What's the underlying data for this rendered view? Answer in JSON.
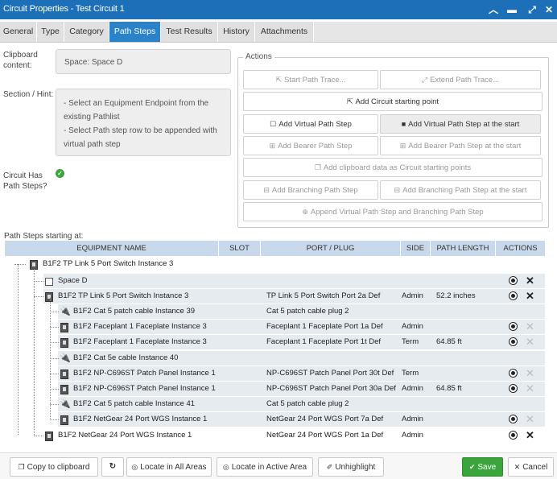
{
  "window": {
    "title": "Circuit Properties - Test Circuit 1",
    "controls": [
      "chevron-up",
      "minimize",
      "expand",
      "close"
    ]
  },
  "tabs": [
    {
      "label": "General",
      "active": false
    },
    {
      "label": "Type",
      "active": false
    },
    {
      "label": "Category",
      "active": false
    },
    {
      "label": "Path Steps",
      "active": true
    },
    {
      "label": "Test Results",
      "active": false
    },
    {
      "label": "History",
      "active": false
    },
    {
      "label": "Attachments",
      "active": false
    }
  ],
  "left": {
    "clipboard_label": "Clipboard content:",
    "clipboard_value": "Space: Space D",
    "hint_label": "Section / Hint:",
    "hint_line1": "- Select an Equipment Endpoint from the existing Pathlist",
    "hint_line2": "- Select Path step row to be appended with virtual path step",
    "has_steps_label": "Circuit Has Path Steps?"
  },
  "actions": {
    "legend": "Actions",
    "start_trace": "Start Path Trace...",
    "extend_trace": "Extend Path Trace...",
    "add_start_point": "Add Circuit starting point",
    "add_virtual": "Add Virtual Path Step",
    "add_virtual_start": "Add Virtual Path Step at the start",
    "add_bearer": "Add Bearer Path Step",
    "add_bearer_start": "Add Bearer Path Step at the start",
    "add_clipboard": "Add clipboard data as Circuit starting points",
    "add_branching": "Add Branching Path Step",
    "add_branching_start": "Add Branching Path Step at the start",
    "append_virtual_branching": "Append Virtual Path Step and Branching Path Step"
  },
  "grid": {
    "caption": "Path Steps starting at:",
    "columns": [
      "EQUIPMENT NAME",
      "SLOT",
      "PORT / PLUG",
      "SIDE",
      "PATH LENGTH",
      "ACTIONS"
    ],
    "root": "B1F2 TP Link 5 Port Switch Instance 3",
    "rows": [
      {
        "name": "Space D",
        "port": "",
        "side": "",
        "length": "",
        "icon": "space",
        "target": true,
        "x": "active"
      },
      {
        "name": "B1F2 TP Link 5 Port Switch Instance 3",
        "port": "TP Link 5 Port Switch Port 2a Def",
        "side": "Admin",
        "length": "52.2 inches",
        "icon": "equipment",
        "target": true,
        "x": "active"
      },
      {
        "name": "B1F2 Cat 5 patch cable Instance 39",
        "port": "Cat 5 patch cable plug 2",
        "side": "",
        "length": "",
        "icon": "cable",
        "target": false,
        "x": "none"
      },
      {
        "name": "B1F2 Faceplant 1 Faceplate Instance 3",
        "port": "Faceplant 1 Faceplate Port 1a Def",
        "side": "Admin",
        "length": "",
        "icon": "equipment",
        "target": true,
        "x": "disabled"
      },
      {
        "name": "B1F2 Faceplant 1 Faceplate Instance 3",
        "port": "Faceplant 1 Faceplate Port 1t Def",
        "side": "Term",
        "length": "64.85 ft",
        "icon": "equipment",
        "target": true,
        "x": "disabled"
      },
      {
        "name": "B1F2 Cat 5e cable Instance 40",
        "port": "",
        "side": "",
        "length": "",
        "icon": "cable",
        "target": false,
        "x": "none"
      },
      {
        "name": "B1F2 NP-C696ST Patch Panel Instance 1",
        "port": "NP-C696ST Patch Panel Port 30t Def",
        "side": "Term",
        "length": "",
        "icon": "equipment",
        "target": true,
        "x": "disabled"
      },
      {
        "name": "B1F2 NP-C696ST Patch Panel Instance 1",
        "port": "NP-C696ST Patch Panel Port 30a Def",
        "side": "Admin",
        "length": "64.85 ft",
        "icon": "equipment",
        "target": true,
        "x": "disabled"
      },
      {
        "name": "B1F2 Cat 5 patch cable Instance 41",
        "port": "Cat 5 patch cable plug 2",
        "side": "",
        "length": "",
        "icon": "cable",
        "target": false,
        "x": "none"
      },
      {
        "name": "B1F2 NetGear 24 Port WGS Instance 1",
        "port": "NetGear 24 Port WGS Port 7a Def",
        "side": "Admin",
        "length": "",
        "icon": "equipment",
        "target": true,
        "x": "disabled"
      },
      {
        "name": "B1F2 NetGear 24 Port WGS Instance 1",
        "port": "NetGear 24 Port WGS Port 1a Def",
        "side": "Admin",
        "length": "",
        "icon": "equipment",
        "target": true,
        "x": "active"
      }
    ]
  },
  "footer": {
    "copy": "Copy to clipboard",
    "locate_all": "Locate in All Areas",
    "locate_active": "Locate in Active Area",
    "unhighlight": "Unhighlight",
    "save": "Save",
    "cancel": "Cancel"
  },
  "colors": {
    "titlebar": "#1d70b7",
    "active_tab": "#2a82c8",
    "save": "#3aa53a",
    "check": "#3aa53a"
  }
}
